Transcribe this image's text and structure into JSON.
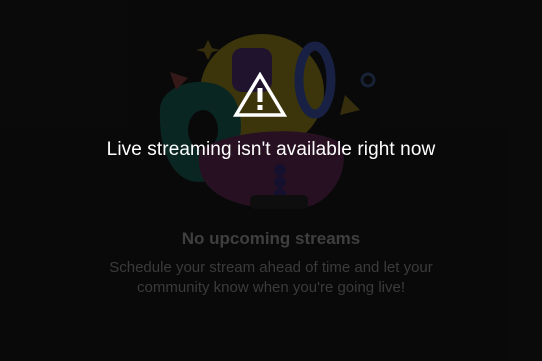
{
  "error": {
    "message": "Live streaming isn't available right now",
    "icon": "warning-triangle-icon",
    "color": "#ffffff"
  },
  "empty_state": {
    "title": "No upcoming streams",
    "description": "Schedule your stream ahead of time and let your community know when you're going live!",
    "illustration": "party-illustration"
  },
  "colors": {
    "background": "#0a0a0a",
    "dim_text": "#3f3f3f"
  }
}
